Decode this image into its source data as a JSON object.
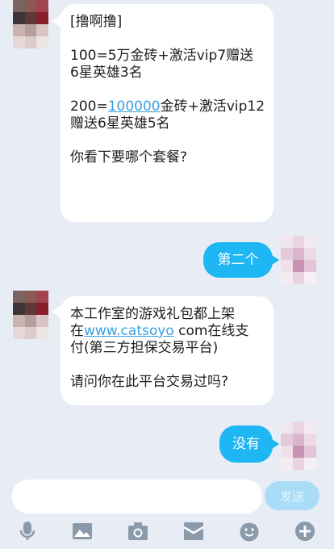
{
  "messages": [
    {
      "side": "in",
      "lines": [
        "[撸啊撸]",
        "100=5万金砖+激活vip7赠送\n6星英雄3名",
        "",
        "你看下要哪个套餐?"
      ],
      "line2_prefix": "200=",
      "line2_link": "100000",
      "line2_rest": "金砖+激活vip12",
      "line2_wrap": "赠送6星英雄5名"
    },
    {
      "side": "out",
      "text": "第二个"
    },
    {
      "side": "in",
      "text1": "本工作室的游戏礼包都上架",
      "text2_prefix": "在",
      "text2_link": "www.catsoyo",
      "text2_rest": " com在线支",
      "text3": "付(第三方担保交易平台)",
      "text4": "请问你在此平台交易过吗?"
    },
    {
      "side": "out",
      "text": "没有"
    }
  ],
  "composer": {
    "placeholder": "",
    "send_label": "发送"
  },
  "toolbar": [
    "microphone-icon",
    "image-icon",
    "camera-icon",
    "gift-icon",
    "emoji-icon",
    "plus-icon"
  ],
  "colors": {
    "background": "#e8ecf4",
    "accent": "#1fb6f4",
    "send_disabled": "#a9dcf6"
  }
}
